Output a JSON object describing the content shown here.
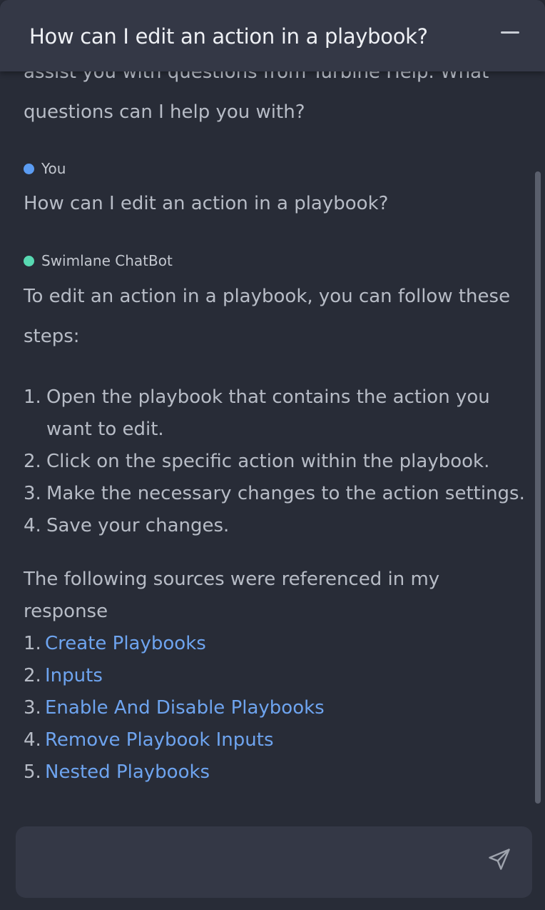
{
  "header": {
    "title": "How can I edit an action in a playbook?"
  },
  "conversation": {
    "intro_partial_line": "assist you with questions from Turbine Help. What",
    "intro_last_line": "questions can I help you with?",
    "user": {
      "sender": "You",
      "dot_color": "#5b9cf2",
      "message": "How can I edit an action in a playbook?"
    },
    "bot": {
      "sender": "Swimlane ChatBot",
      "dot_color": "#58d9b2",
      "intro_line1": "To edit an action in a playbook, you can follow these",
      "intro_line2": "steps:",
      "steps": [
        {
          "num": "1.",
          "line1": "Open the playbook that contains the action you",
          "line2": "want to edit."
        },
        {
          "num": "2.",
          "line1": "Click on the specific action within the playbook."
        },
        {
          "num": "3.",
          "line1": "Make the necessary changes to the action settings."
        },
        {
          "num": "4.",
          "line1": "Save your changes."
        }
      ],
      "sources_intro_line1": "The following sources were referenced in my",
      "sources_intro_line2": "response",
      "sources": [
        {
          "num": "1.",
          "label": "Create Playbooks"
        },
        {
          "num": "2.",
          "label": "Inputs"
        },
        {
          "num": "3.",
          "label": "Enable And Disable Playbooks"
        },
        {
          "num": "4.",
          "label": "Remove Playbook Inputs"
        },
        {
          "num": "5.",
          "label": "Nested Playbooks"
        }
      ]
    }
  },
  "composer": {
    "input_value": "",
    "send_icon": "paper-plane-icon"
  },
  "colors": {
    "background": "#282c37",
    "header": "#343846",
    "link": "#6ea4ef"
  }
}
